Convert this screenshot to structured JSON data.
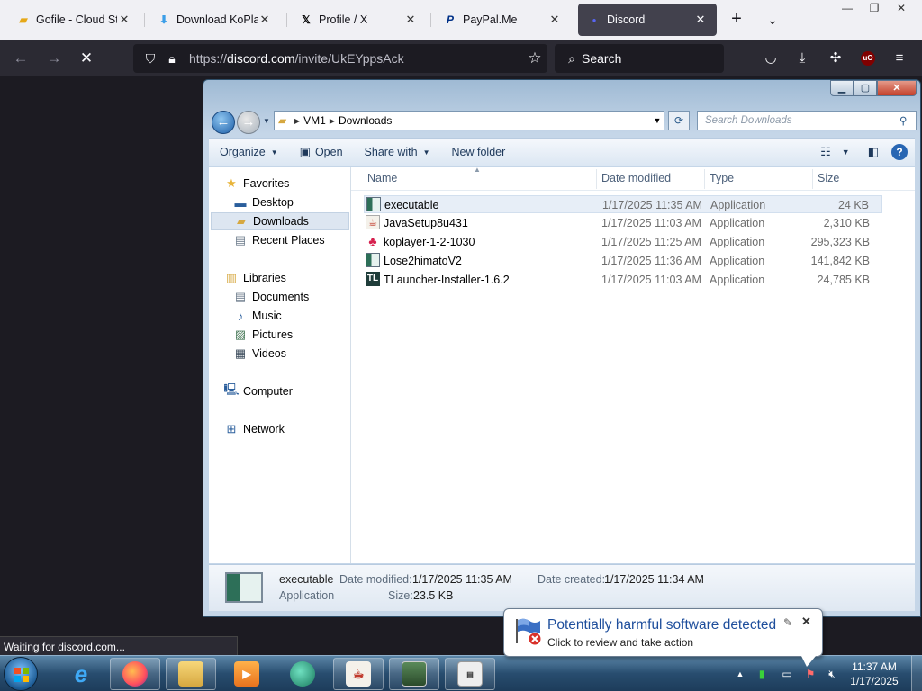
{
  "browser": {
    "tabs": [
      {
        "title": "Gofile - Cloud Stora",
        "icon": "gofile-icon"
      },
      {
        "title": "Download KoPlayer",
        "icon": "koplayer-download-icon"
      },
      {
        "title": "Profile / X",
        "icon": "x-logo-icon"
      },
      {
        "title": "PayPal.Me",
        "icon": "paypal-icon"
      },
      {
        "title": "Discord",
        "icon": "discord-icon"
      }
    ],
    "url_prefix": "https://",
    "url_host": "discord.com",
    "url_path": "/invite/UkEYppsAck",
    "search_placeholder": "Search",
    "ublock_label": "uO",
    "status": "Waiting for discord.com..."
  },
  "explorer": {
    "breadcrumb": [
      "VM1",
      "Downloads"
    ],
    "search_placeholder": "Search Downloads",
    "commands": {
      "organize": "Organize",
      "open": "Open",
      "share": "Share with",
      "newfolder": "New folder"
    },
    "nav": {
      "favorites": "Favorites",
      "desktop": "Desktop",
      "downloads": "Downloads",
      "recent": "Recent Places",
      "libraries": "Libraries",
      "documents": "Documents",
      "music": "Music",
      "pictures": "Pictures",
      "videos": "Videos",
      "computer": "Computer",
      "network": "Network"
    },
    "columns": {
      "name": "Name",
      "date": "Date modified",
      "type": "Type",
      "size": "Size"
    },
    "files": [
      {
        "name": "executable",
        "date": "1/17/2025 11:35 AM",
        "type": "Application",
        "size": "24 KB",
        "icon": "app-window-icon"
      },
      {
        "name": "JavaSetup8u431",
        "date": "1/17/2025 11:03 AM",
        "type": "Application",
        "size": "2,310 KB",
        "icon": "java-icon"
      },
      {
        "name": "koplayer-1-2-1030",
        "date": "1/17/2025 11:25 AM",
        "type": "Application",
        "size": "295,323 KB",
        "icon": "koplayer-icon"
      },
      {
        "name": "Lose2himatoV2",
        "date": "1/17/2025 11:36 AM",
        "type": "Application",
        "size": "141,842 KB",
        "icon": "app-window-icon"
      },
      {
        "name": "TLauncher-Installer-1.6.2",
        "date": "1/17/2025 11:03 AM",
        "type": "Application",
        "size": "24,785 KB",
        "icon": "tlauncher-icon"
      }
    ],
    "details": {
      "name": "executable",
      "type": "Application",
      "modified_label": "Date modified:",
      "modified_value": "1/17/2025 11:35 AM",
      "created_label": "Date created:",
      "created_value": "1/17/2025 11:34 AM",
      "size_label": "Size:",
      "size_value": "23.5 KB"
    }
  },
  "notification": {
    "title": "Potentially harmful software detected",
    "message": "Click to review and take action"
  },
  "taskbar": {
    "time": "11:37 AM",
    "date": "1/17/2025"
  },
  "colors": {
    "ff_dark": "#2b2a33",
    "ff_light": "#f0f0f4",
    "win7_blue": "#1e4e9c",
    "selection": "#e7eef7"
  }
}
